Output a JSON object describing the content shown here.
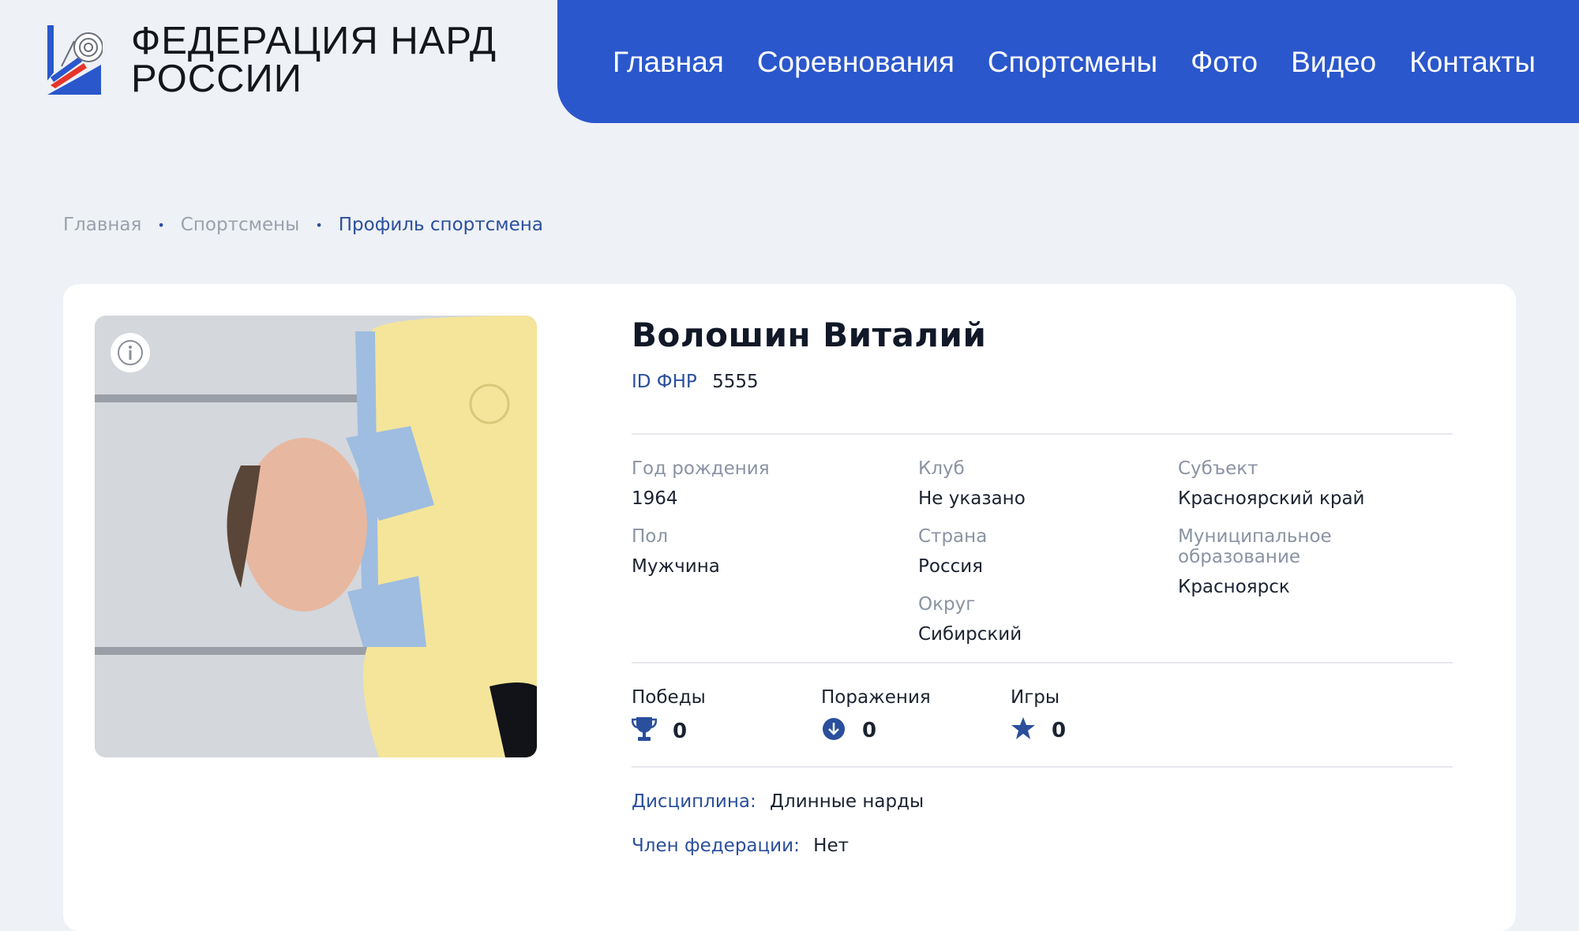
{
  "brand": {
    "line1": "ФЕДЕРАЦИЯ НАРД",
    "line2": "РОССИИ"
  },
  "nav": [
    {
      "label": "Главная"
    },
    {
      "label": "Соревнования"
    },
    {
      "label": "Спортсмены"
    },
    {
      "label": "Фото"
    },
    {
      "label": "Видео"
    },
    {
      "label": "Контакты"
    }
  ],
  "breadcrumb": [
    {
      "label": "Главная"
    },
    {
      "label": "Спортсмены"
    },
    {
      "label": "Профиль спортсмена"
    }
  ],
  "profile": {
    "name": "Волошин Виталий",
    "id_label": "ID ФНР",
    "id_value": "5555",
    "fields": {
      "birth_year": {
        "label": "Год рождения",
        "value": "1964"
      },
      "gender": {
        "label": "Пол",
        "value": "Мужчина"
      },
      "club": {
        "label": "Клуб",
        "value": "Не указано"
      },
      "country": {
        "label": "Страна",
        "value": "Россия"
      },
      "district": {
        "label": "Округ",
        "value": "Сибирский"
      },
      "subject": {
        "label": "Субъект",
        "value": "Красноярский край"
      },
      "municipality": {
        "label": "Муниципальное образование",
        "value": "Красноярск"
      }
    },
    "stats": {
      "wins": {
        "label": "Победы",
        "value": "0",
        "icon": "trophy-icon"
      },
      "losses": {
        "label": "Поражения",
        "value": "0",
        "icon": "arrow-down-circle-icon"
      },
      "games": {
        "label": "Игры",
        "value": "0",
        "icon": "star-icon"
      }
    },
    "discipline": {
      "label": "Дисциплина:",
      "value": "Длинные нарды"
    },
    "member": {
      "label": "Член федерации:",
      "value": "Нет"
    }
  },
  "colors": {
    "accent": "#2a57cc",
    "link": "#2a4f9c",
    "background": "#eef1f6"
  }
}
